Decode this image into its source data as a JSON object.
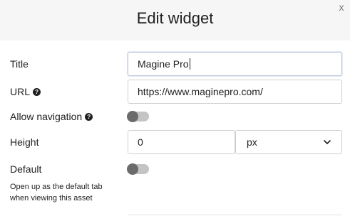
{
  "dialog": {
    "title": "Edit widget",
    "close_glyph": "x"
  },
  "fields": {
    "title": {
      "label": "Title",
      "value": "Magine Pro"
    },
    "url": {
      "label": "URL",
      "value": "https://www.maginepro.com/",
      "help_icon": "question-circle-icon"
    },
    "allow_navigation": {
      "label": "Allow navigation",
      "enabled": false,
      "help_icon": "question-circle-icon"
    },
    "height": {
      "label": "Height",
      "value": "0",
      "unit": "px",
      "unit_options": [
        "px"
      ]
    },
    "default": {
      "label": "Default",
      "enabled": false,
      "description": "Open up as the default tab when viewing this asset"
    }
  },
  "colors": {
    "header_bg": "#f6f6f6",
    "text": "#1f1f1f",
    "toggle_track": "#c4c4c4",
    "toggle_knob": "#6b6b6b",
    "input_border": "#cfcfcf"
  }
}
